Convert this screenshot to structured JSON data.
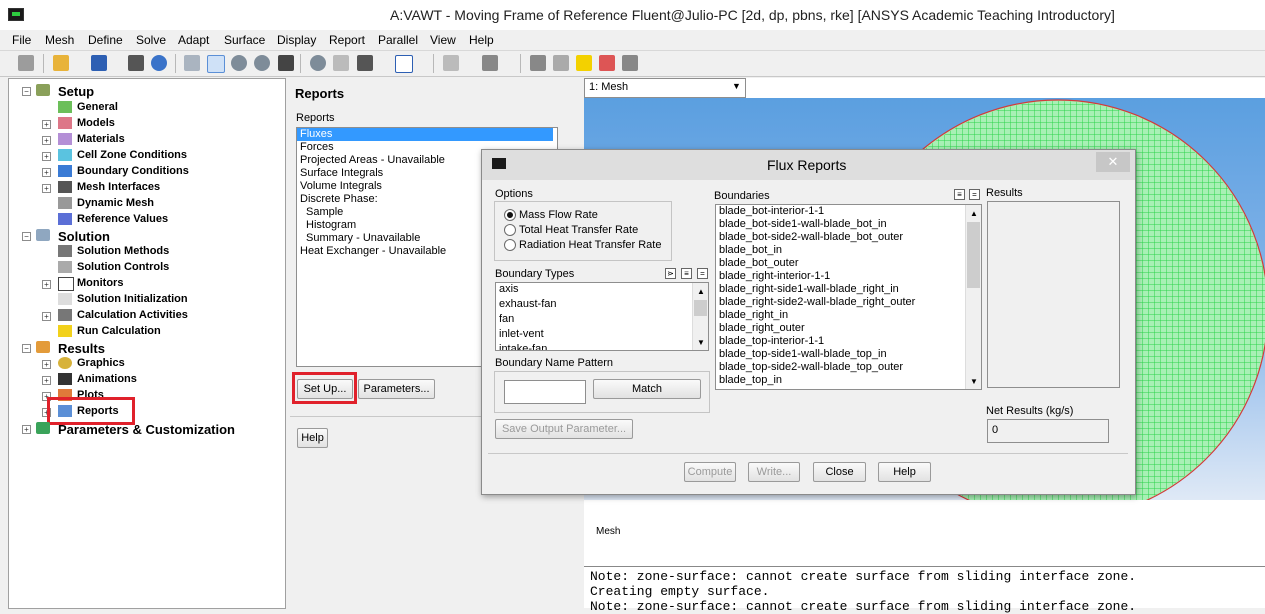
{
  "window": {
    "title": "A:VAWT - Moving Frame of Reference Fluent@Julio-PC  [2d, dp, pbns, rke] [ANSYS Academic Teaching Introductory]"
  },
  "menubar": [
    "File",
    "Mesh",
    "Define",
    "Solve",
    "Adapt",
    "Surface",
    "Display",
    "Report",
    "Parallel",
    "View",
    "Help"
  ],
  "tree": {
    "setup": "Setup",
    "setup_items": [
      "General",
      "Models",
      "Materials",
      "Cell Zone Conditions",
      "Boundary Conditions",
      "Mesh Interfaces",
      "Dynamic Mesh",
      "Reference Values"
    ],
    "solution": "Solution",
    "solution_items": [
      "Solution Methods",
      "Solution Controls",
      "Monitors",
      "Solution Initialization",
      "Calculation Activities",
      "Run Calculation"
    ],
    "results": "Results",
    "results_items": [
      "Graphics",
      "Animations",
      "Plots",
      "Reports"
    ],
    "params": "Parameters & Customization"
  },
  "reports_panel": {
    "title": "Reports",
    "list_label": "Reports",
    "items": [
      "Fluxes",
      "Forces",
      "Projected Areas - Unavailable",
      "Surface Integrals",
      "Volume Integrals",
      "Discrete Phase:",
      "Sample",
      "Histogram",
      "Summary - Unavailable",
      "Heat Exchanger - Unavailable"
    ],
    "setup_btn": "Set Up...",
    "params_btn": "Parameters...",
    "help_btn": "Help"
  },
  "graphics": {
    "select_value": "1: Mesh",
    "label": "Mesh"
  },
  "console": [
    "Note: zone-surface: cannot create surface from sliding interface zone.",
    "Creating empty surface.",
    "Note: zone-surface: cannot create surface from sliding interface zone."
  ],
  "flux_dialog": {
    "title": "Flux Reports",
    "options_label": "Options",
    "options": [
      "Mass Flow Rate",
      "Total Heat Transfer Rate",
      "Radiation Heat Transfer Rate"
    ],
    "boundary_types_label": "Boundary Types",
    "boundary_types": [
      "axis",
      "exhaust-fan",
      "fan",
      "inlet-vent",
      "intake-fan"
    ],
    "boundary_name_pattern_label": "Boundary Name Pattern",
    "pattern_value": "",
    "match_btn": "Match",
    "save_btn": "Save Output Parameter...",
    "boundaries_label": "Boundaries",
    "boundaries": [
      "blade_bot-interior-1-1",
      "blade_bot-side1-wall-blade_bot_in",
      "blade_bot-side2-wall-blade_bot_outer",
      "blade_bot_in",
      "blade_bot_outer",
      "blade_right-interior-1-1",
      "blade_right-side1-wall-blade_right_in",
      "blade_right-side2-wall-blade_right_outer",
      "blade_right_in",
      "blade_right_outer",
      "blade_top-interior-1-1",
      "blade_top-side1-wall-blade_top_in",
      "blade_top-side2-wall-blade_top_outer",
      "blade_top_in"
    ],
    "results_label": "Results",
    "net_results_label": "Net Results (kg/s)",
    "net_results_value": "0",
    "compute_btn": "Compute",
    "write_btn": "Write...",
    "close_btn": "Close",
    "help_btn": "Help",
    "close_x": "✕"
  },
  "colors": {
    "selection": "#3399ff",
    "highlight_box": "#e0212b",
    "mesh": "#17c82e"
  }
}
